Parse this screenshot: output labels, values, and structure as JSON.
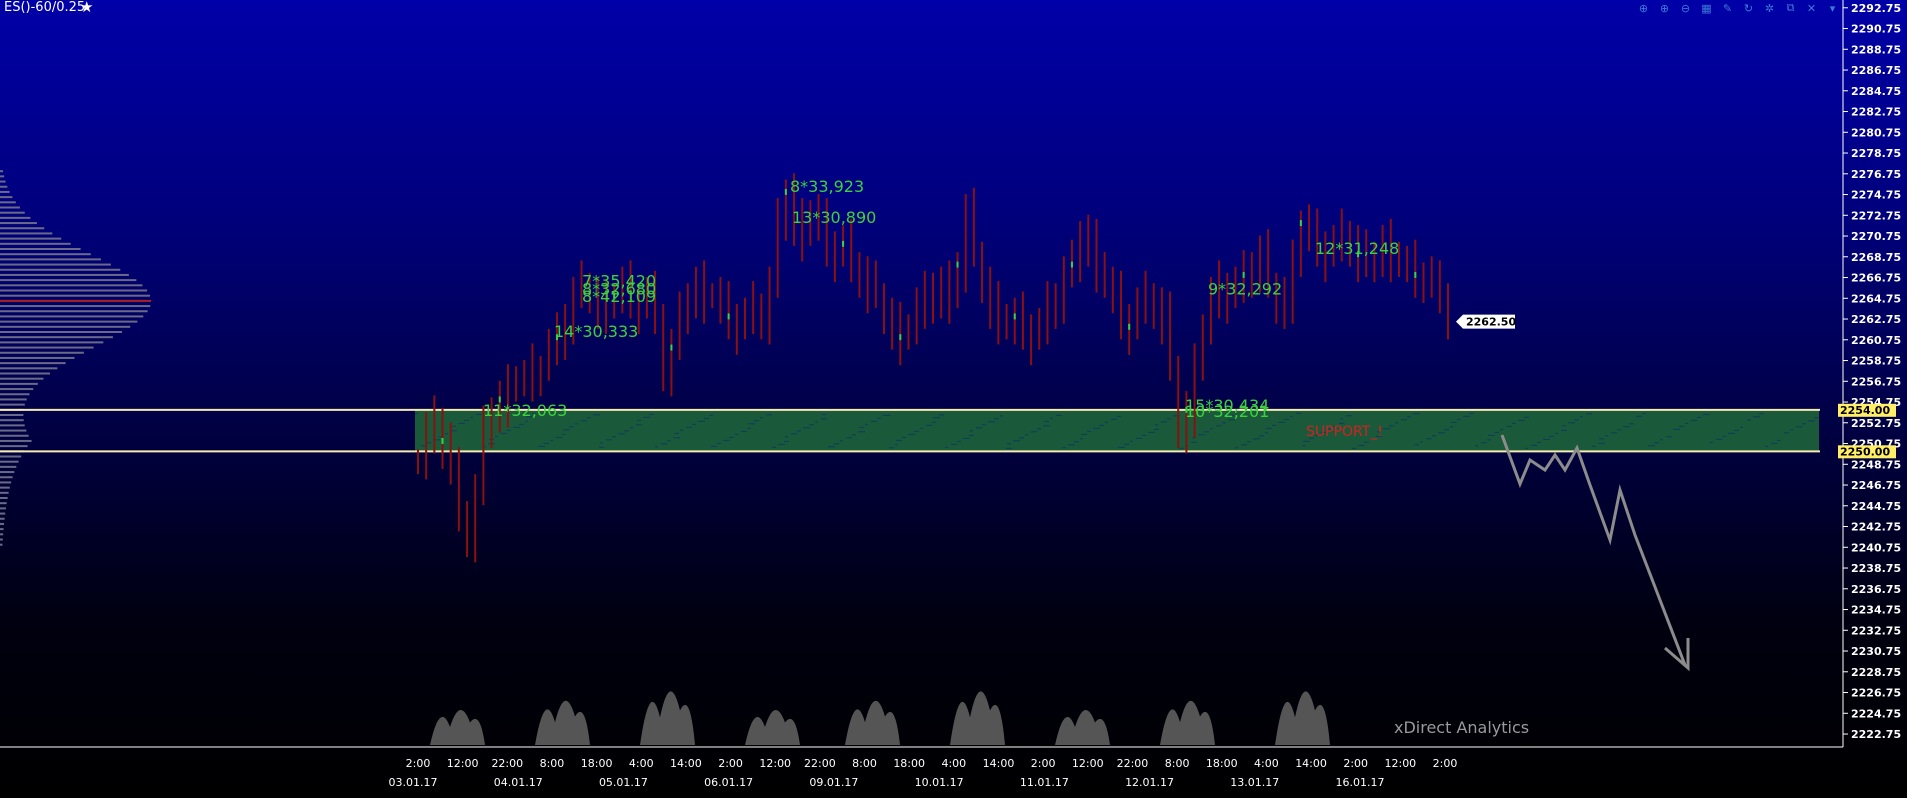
{
  "window": {
    "title": "ES()-60/0.25"
  },
  "toolbar": [
    {
      "name": "zoom-fit-icon",
      "glyph": "⊕"
    },
    {
      "name": "zoom-in-icon",
      "glyph": "⊕"
    },
    {
      "name": "zoom-out-icon",
      "glyph": "⊖"
    },
    {
      "name": "grid-icon",
      "glyph": "▦"
    },
    {
      "name": "pencil-icon",
      "glyph": "✎"
    },
    {
      "name": "refresh-icon",
      "glyph": "↻"
    },
    {
      "name": "gear-icon",
      "glyph": "✲"
    },
    {
      "name": "popout-icon",
      "glyph": "⧉"
    },
    {
      "name": "close-icon",
      "glyph": "✕"
    },
    {
      "name": "menu-down-icon",
      "glyph": "▾"
    }
  ],
  "watermark": "xDirect Analytics",
  "colors": {
    "candle": "#8b1010",
    "label_green": "#3cd23c",
    "zone_fill": "#1f6a3a",
    "level_line": "#f5eab0",
    "axis": "#ffffff",
    "support": "#d42020",
    "arrow": "#8c8c8c"
  },
  "chart_data": {
    "type": "candlestick",
    "y_axis": {
      "min": 2221.5,
      "max": 2293.5,
      "step": 2,
      "ticks": [
        "2292.75",
        "2290.75",
        "2288.75",
        "2286.75",
        "2284.75",
        "2282.75",
        "2280.75",
        "2278.75",
        "2276.75",
        "2274.75",
        "2272.75",
        "2270.75",
        "2268.75",
        "2266.75",
        "2264.75",
        "2262.75",
        "2260.75",
        "2258.75",
        "2256.75",
        "2254.75",
        "2252.75",
        "2250.75",
        "2248.75",
        "2246.75",
        "2244.75",
        "2242.75",
        "2240.75",
        "2238.75",
        "2236.75",
        "2234.75",
        "2232.75",
        "2230.75",
        "2228.75",
        "2226.75",
        "2224.75",
        "2222.75"
      ]
    },
    "x_time_labels": [
      "2:00",
      "12:00",
      "22:00",
      "8:00",
      "18:00",
      "4:00",
      "14:00",
      "2:00",
      "12:00",
      "22:00",
      "8:00",
      "18:00",
      "4:00",
      "14:00",
      "2:00",
      "12:00",
      "22:00",
      "8:00",
      "18:00",
      "4:00",
      "14:00",
      "2:00",
      "12:00",
      "2:00"
    ],
    "x_date_labels": [
      "03.01.17",
      "04.01.17",
      "05.01.17",
      "06.01.17",
      "09.01.17",
      "10.01.17",
      "11.01.17",
      "12.01.17",
      "13.01.17",
      "16.01.17"
    ],
    "closes": [
      2249,
      2252,
      2253,
      2251,
      2248,
      2244,
      2242,
      2246,
      2252,
      2254,
      2255,
      2256,
      2257,
      2257,
      2258,
      2258,
      2260,
      2261,
      2263,
      2265,
      2266,
      2265,
      2264,
      2264,
      2265,
      2266,
      2265,
      2264,
      2265,
      2263,
      2258,
      2260,
      2263,
      2265,
      2266,
      2265,
      2265,
      2264,
      2263,
      2262,
      2263,
      2264,
      2263,
      2266,
      2272,
      2275,
      2272,
      2271,
      2273,
      2272,
      2270,
      2269,
      2270,
      2268,
      2267,
      2266,
      2265,
      2263,
      2262,
      2261,
      2262,
      2264,
      2265,
      2266,
      2264,
      2266,
      2268,
      2273,
      2269,
      2266,
      2264,
      2263,
      2262,
      2263,
      2262,
      2261,
      2262,
      2264,
      2265,
      2267,
      2268,
      2271,
      2270,
      2268,
      2266,
      2265,
      2263,
      2262,
      2264,
      2265,
      2264,
      2263,
      2258,
      2252,
      2254,
      2258,
      2262,
      2265,
      2266,
      2265,
      2266,
      2267,
      2268,
      2269,
      2266,
      2264,
      2265,
      2268,
      2272,
      2271,
      2270,
      2269,
      2270,
      2271,
      2270,
      2269,
      2268,
      2269,
      2270,
      2269,
      2268,
      2268,
      2267,
      2267,
      2266,
      2265,
      2263
    ],
    "last_price": "2262.50",
    "levels": [
      {
        "value": 2254.0,
        "label": "2254.00"
      },
      {
        "value": 2250.0,
        "label": "2250.00"
      }
    ],
    "zone": {
      "from": 2250.0,
      "to": 2254.0,
      "label": "SUPPORT_!"
    },
    "annotations": [
      "11*32,063",
      "14*30,333",
      "7*35,420",
      "8*32,680",
      "8*42,109",
      "8*33,923",
      "13*30,890",
      "9*32,292",
      "12*31,248",
      "15*30,434",
      "10*32,201"
    ]
  }
}
